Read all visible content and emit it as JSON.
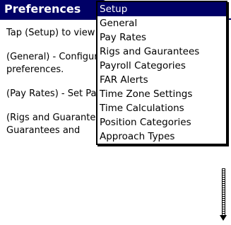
{
  "form": {
    "title": "Preferences"
  },
  "help": {
    "paragraph_1": "Tap (Setup) to view the following preferences.",
    "paragraph_2": "(General) - Configure Domicile, YTD and other preferences.",
    "paragraph_3": "(Pay Rates) - Set Pay Rates and PerDiem.",
    "paragraph_4": "(Rigs and Guarantees) - Adjust Trip/Leg Guarantees and"
  },
  "menu": {
    "items": [
      {
        "label": "Setup",
        "selected": true
      },
      {
        "label": "General",
        "selected": false
      },
      {
        "label": "Pay Rates",
        "selected": false
      },
      {
        "label": "Rigs and Gaurantees",
        "selected": false
      },
      {
        "label": "Payroll Categories",
        "selected": false
      },
      {
        "label": "FAR Alerts",
        "selected": false
      },
      {
        "label": "Time Zone Settings",
        "selected": false
      },
      {
        "label": "Time Calculations",
        "selected": false
      },
      {
        "label": "Position Categories",
        "selected": false
      },
      {
        "label": "Approach Types",
        "selected": false
      }
    ]
  },
  "colors": {
    "title_bar": "#000066",
    "selection": "#000066",
    "background": "#ffffff"
  },
  "icons": {
    "scroll_down": "scroll-down-arrow-icon"
  }
}
